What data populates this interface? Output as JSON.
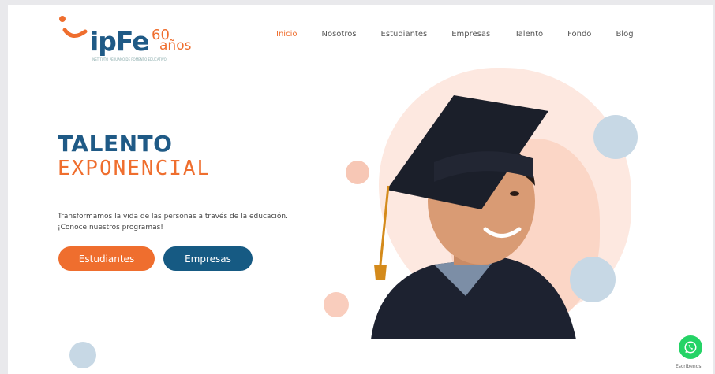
{
  "brand": {
    "logo_text": "ipFe",
    "anniversary_number": "60",
    "anniversary_word": "años",
    "tagline": "INSTITUTO PERUANO DE FOMENTO EDUCATIVO"
  },
  "nav": {
    "items": [
      {
        "label": "Inicio",
        "active": true
      },
      {
        "label": "Nosotros",
        "active": false
      },
      {
        "label": "Estudiantes",
        "active": false
      },
      {
        "label": "Empresas",
        "active": false
      },
      {
        "label": "Talento",
        "active": false
      },
      {
        "label": "Fondo",
        "active": false
      },
      {
        "label": "Blog",
        "active": false
      }
    ]
  },
  "hero": {
    "title": "TALENTO",
    "subtitle": "EXPONENCIAL",
    "description_line1": "Transformamos la vida de las personas a través de la educación.",
    "description_line2": "¡Conoce nuestros programas!",
    "button_students": "Estudiantes",
    "button_companies": "Empresas"
  },
  "whatsapp": {
    "label": "Escríbenos"
  },
  "colors": {
    "primary_blue": "#1f5a86",
    "accent_orange": "#ef6e2e",
    "whatsapp_green": "#25d366"
  }
}
